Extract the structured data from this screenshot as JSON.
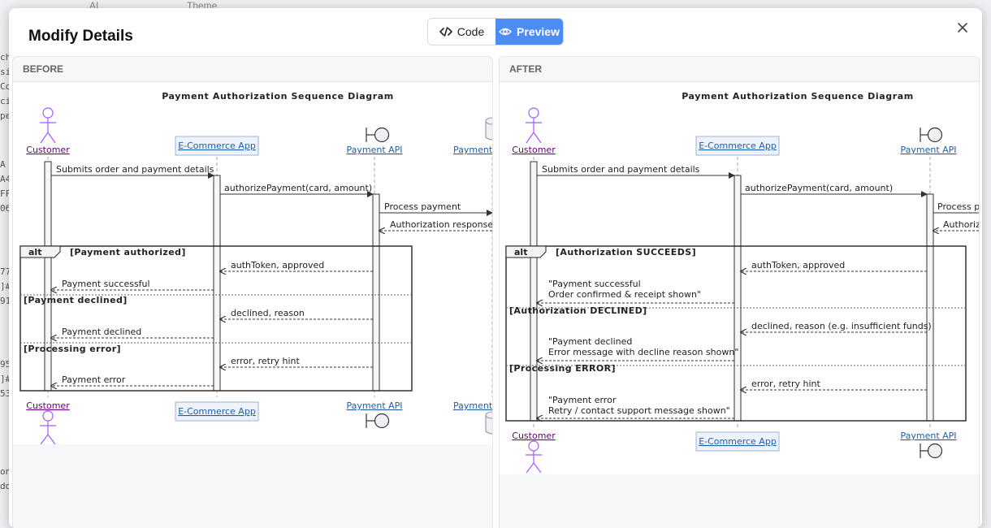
{
  "background": {
    "toolbar_items": [
      "AI",
      "Theme"
    ],
    "code_fragments": [
      "ch",
      "si",
      "Co",
      "ci",
      "pe",
      "A",
      "A4",
      "FF",
      "06",
      "77",
      "]#",
      "91",
      "95",
      "]#",
      "53",
      "on",
      "dd"
    ]
  },
  "modal": {
    "title": "Modify Details",
    "tabs": [
      {
        "label": "Code",
        "icon": "code-icon"
      },
      {
        "label": "Preview",
        "icon": "eye-icon"
      }
    ],
    "active_tab": "Preview",
    "close_icon": "close-icon"
  },
  "before": {
    "label": "BEFORE",
    "diagram": {
      "title": "Payment Authorization Sequence Diagram",
      "participants": [
        "Customer",
        "E-Commerce App",
        "Payment API",
        "Payment"
      ],
      "messages": [
        "Submits order and payment details",
        "authorizePayment(card, amount)",
        "Process payment",
        "Authorization response"
      ],
      "alt_label": "alt",
      "sections": [
        {
          "guard": "[Payment authorized]",
          "messages": [
            "authToken, approved",
            "Payment successful"
          ]
        },
        {
          "guard": "[Payment declined]",
          "messages": [
            "declined, reason",
            "Payment declined"
          ]
        },
        {
          "guard": "[Processing error]",
          "messages": [
            "error, retry hint",
            "Payment error"
          ]
        }
      ]
    }
  },
  "after": {
    "label": "AFTER",
    "diagram": {
      "title": "Payment Authorization Sequence Diagram",
      "participants": [
        "Customer",
        "E-Commerce App",
        "Payment API"
      ],
      "messages": [
        "Submits order and payment details",
        "authorizePayment(card, amount)",
        "Process p",
        "Authoriz"
      ],
      "alt_label": "alt",
      "sections": [
        {
          "guard": "[Authorization SUCCEEDS]",
          "messages": [
            "authToken, approved",
            "\"Payment successful",
            "Order confirmed & receipt shown\""
          ]
        },
        {
          "guard": "[Authorization DECLINED]",
          "messages": [
            "declined, reason (e.g. insufficient funds)",
            "\"Payment declined",
            "Error message with decline reason shown\""
          ]
        },
        {
          "guard": "[Processing ERROR]",
          "messages": [
            "error, retry hint",
            "\"Payment error",
            "Retry / contact support message shown\""
          ]
        }
      ]
    }
  }
}
